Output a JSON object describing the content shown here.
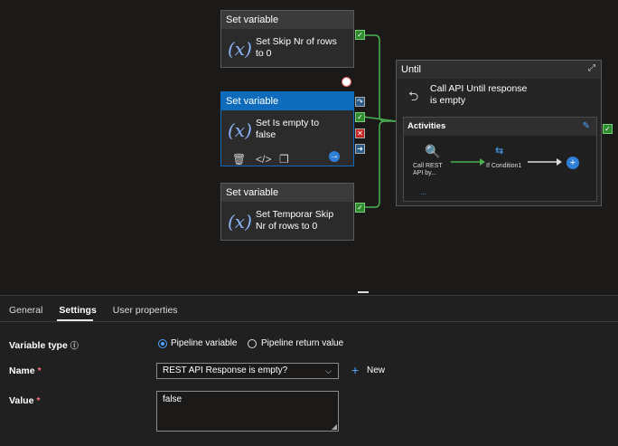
{
  "canvas": {
    "cards": [
      {
        "header": "Set variable",
        "label": "Set Skip Nr of rows to 0"
      },
      {
        "header": "Set variable",
        "label": "Set Is empty to false"
      },
      {
        "header": "Set variable",
        "label": "Set Temporar Skip Nr of rows to 0"
      }
    ],
    "until": {
      "header": "Until",
      "label": "Call API Until response is empty",
      "activities_title": "Activities",
      "items": [
        {
          "label": "Call REST API by..."
        },
        {
          "label": "If Condition1"
        }
      ],
      "more": "..."
    },
    "variable_symbol": "(x)"
  },
  "panel": {
    "tabs": [
      "General",
      "Settings",
      "User properties"
    ],
    "variable_type": {
      "label": "Variable type",
      "options": [
        "Pipeline variable",
        "Pipeline return value"
      ],
      "selected": "Pipeline variable"
    },
    "name": {
      "label": "Name",
      "value": "REST API Response is empty?",
      "new_label": "New"
    },
    "value": {
      "label": "Value",
      "text": "false"
    }
  },
  "colors": {
    "accent": "#0f6cbd",
    "success": "#2e8b2e",
    "required": "#f1707b"
  }
}
